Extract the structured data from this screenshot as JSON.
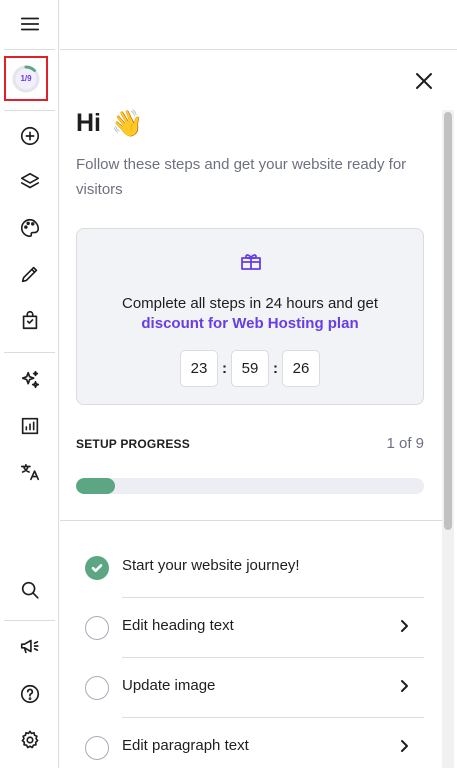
{
  "sidebar": {
    "progress_badge": "1/9",
    "progress_fraction": 0.111,
    "items": [
      {
        "name": "menu-icon"
      },
      {
        "name": "add-element-icon"
      },
      {
        "name": "layers-icon"
      },
      {
        "name": "palette-icon"
      },
      {
        "name": "pencil-icon"
      },
      {
        "name": "store-bag-icon"
      },
      {
        "name": "ai-sparkles-icon"
      },
      {
        "name": "analytics-icon"
      },
      {
        "name": "translate-icon"
      },
      {
        "name": "search-icon"
      },
      {
        "name": "megaphone-icon"
      },
      {
        "name": "help-icon"
      },
      {
        "name": "settings-icon"
      }
    ]
  },
  "panel": {
    "greeting": "Hi",
    "greeting_emoji": "👋",
    "subtext": "Follow these steps and get your website ready for visitors",
    "promo": {
      "text": "Complete all steps in 24 hours and get",
      "link": "discount for Web Hosting plan",
      "timer": {
        "hours": "23",
        "minutes": "59",
        "seconds": "26",
        "separator": ":"
      }
    },
    "setup": {
      "label": "SETUP PROGRESS",
      "count": "1 of 9",
      "progress_fraction": 0.111
    },
    "steps": [
      {
        "label": "Start your website journey!",
        "done": true
      },
      {
        "label": "Edit heading text",
        "done": false
      },
      {
        "label": "Update image",
        "done": false
      },
      {
        "label": "Edit paragraph text",
        "done": false
      }
    ]
  },
  "colors": {
    "accent": "#673de6",
    "success": "#5ca684",
    "highlight_border": "#e0202b"
  }
}
